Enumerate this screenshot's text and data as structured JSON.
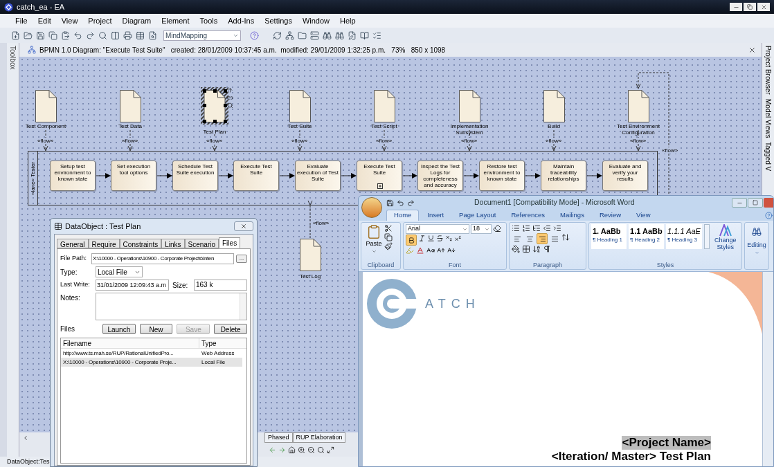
{
  "window": {
    "title": "catch_ea - EA"
  },
  "menu": [
    "File",
    "Edit",
    "View",
    "Project",
    "Diagram",
    "Element",
    "Tools",
    "Add-Ins",
    "Settings",
    "Window",
    "Help"
  ],
  "toolbar": {
    "perspective": "MindMapping"
  },
  "toolbox": {
    "label": "Toolbox"
  },
  "diagram": {
    "header": "BPMN 1.0 Diagram: \"Execute Test Suite\"   created: 28/01/2009 10:37:45 a.m.  modified: 29/01/2009 1:32:25 p.m.   73%   850 x 1098",
    "documents": [
      {
        "label": "Test Component",
        "flow_label": "«flow»",
        "selected": false
      },
      {
        "label": "Test Data",
        "flow_label": "«flow»",
        "selected": false
      },
      {
        "label": "Test Plan",
        "flow_label": "«flow»",
        "selected": true
      },
      {
        "label": "Test Suite",
        "flow_label": "«flow»",
        "selected": false
      },
      {
        "label": "Test Script",
        "flow_label": "«flow»",
        "selected": false
      },
      {
        "label": "Implementation Subsystem",
        "flow_label": "«flow»",
        "selected": false
      },
      {
        "label": "Build",
        "flow_label": "«flow»",
        "selected": false
      },
      {
        "label": "Test Environment Configuration",
        "flow_label": "«flow»",
        "selected": false
      }
    ],
    "lane": {
      "label": "«lane» Tester"
    },
    "tasks": [
      {
        "label": "Setup test environment to known state",
        "subprocess": false
      },
      {
        "label": "Set execution tool options",
        "subprocess": false
      },
      {
        "label": "Schedule Test Suite execution",
        "subprocess": false
      },
      {
        "label": "Execute Test Suite",
        "subprocess": false
      },
      {
        "label": "Evaluate execution of Test Suite",
        "subprocess": false
      },
      {
        "label": "Execute Test Suite",
        "subprocess": true
      },
      {
        "label": "Inspect the Test Logs for completeness and accuracy",
        "subprocess": false
      },
      {
        "label": "Restore test environment to known state",
        "subprocess": false
      },
      {
        "label": "Maintain traceability relationships",
        "subprocess": false
      },
      {
        "label": "Evaluate and verify your results",
        "subprocess": false
      }
    ],
    "feedback_flow_label": "«flow»",
    "test_log": {
      "label": "Test Log",
      "flow_label": "«flow»"
    },
    "tabs": [
      {
        "label": "Phased"
      },
      {
        "label": "RUP Elaboration"
      }
    ]
  },
  "side_tabs": [
    "Project Browser",
    "Model Views",
    "Tagged V"
  ],
  "status_bar": "DataObject:Tes",
  "dialog": {
    "title": "DataObject : Test Plan",
    "tabs": [
      {
        "label": "General",
        "selected": false
      },
      {
        "label": "Require",
        "selected": false
      },
      {
        "label": "Constraints",
        "selected": false
      },
      {
        "label": "Links",
        "selected": false
      },
      {
        "label": "Scenario",
        "selected": false
      },
      {
        "label": "Files",
        "selected": true
      }
    ],
    "file_path": {
      "label": "File Path:",
      "value": "X:\\10000 - Operations\\10900 - Corporate Projects\\Inten"
    },
    "browse": "...",
    "type": {
      "label": "Type:",
      "value": "Local File"
    },
    "last_write": {
      "label": "Last Write:",
      "value": "31/01/2009 12:09:43 a.m"
    },
    "size": {
      "label": "Size:",
      "value": "163 k"
    },
    "notes": {
      "label": "Notes:"
    },
    "buttons": [
      {
        "label": "Launch",
        "disabled": false
      },
      {
        "label": "New",
        "disabled": false
      },
      {
        "label": "Save",
        "disabled": true
      },
      {
        "label": "Delete",
        "disabled": false
      }
    ],
    "files_label": "Files",
    "columns": [
      "Filename",
      "Type"
    ],
    "rows": [
      {
        "filename": "http://www.ts.mah.se/RUP/RationalUnifiedPro...",
        "type": "Web Address",
        "selected": false
      },
      {
        "filename": "X:\\10000 - Operations\\10900 - Corporate Proje...",
        "type": "Local File",
        "selected": true
      }
    ]
  },
  "word": {
    "title": "Document1 [Compatibility Mode] - Microsoft Word",
    "tabs": [
      {
        "label": "Home",
        "selected": true
      },
      {
        "label": "Insert",
        "selected": false
      },
      {
        "label": "Page Layout",
        "selected": false
      },
      {
        "label": "References",
        "selected": false
      },
      {
        "label": "Mailings",
        "selected": false
      },
      {
        "label": "Review",
        "selected": false
      },
      {
        "label": "View",
        "selected": false
      }
    ],
    "paste": "Paste",
    "font_name": "Arial",
    "font_size": "18",
    "bold": true,
    "align_buttons": [
      {
        "kind": "left",
        "selected": false
      },
      {
        "kind": "center",
        "selected": false
      },
      {
        "kind": "right",
        "selected": true
      },
      {
        "kind": "justify",
        "selected": false
      }
    ],
    "groups": [
      "Clipboard",
      "Font",
      "Paragraph",
      "Styles"
    ],
    "styles": [
      {
        "preview": "1.  AaBb",
        "name": "¶ Heading 1"
      },
      {
        "preview": "1.1  AaBb",
        "name": "¶ Heading 2"
      },
      {
        "preview": "1.1.1  AaE",
        "name": "¶ Heading 3"
      }
    ],
    "change_styles": "Change Styles",
    "editing": "Editing",
    "logo_text": "ATCH",
    "lines": [
      {
        "text": "<Project Name>",
        "highlighted": true
      },
      {
        "text": "<Iteration/ Master> Test Plan",
        "highlighted": false
      }
    ]
  }
}
